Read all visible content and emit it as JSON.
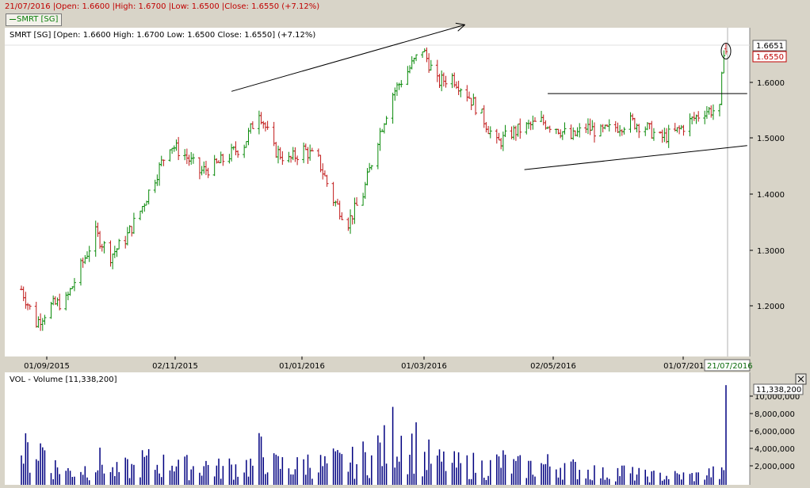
{
  "header": {
    "info_line": "21/07/2016 |Open: 1.6600 |High: 1.6700 |Low: 1.6500 |Close: 1.6550 (+7.12%)",
    "legend_label": "SMRT [SG]"
  },
  "price_panel": {
    "info": "SMRT [SG] [Open: 1.6600  High: 1.6700  Low: 1.6500  Close: 1.6550] (+7.12%)",
    "last_high_label": "1.6651",
    "last_close_label": "1.6550",
    "y_ticks": [
      "1.6000",
      "1.5000",
      "1.4000",
      "1.3000",
      "1.2000"
    ],
    "x_ticks": [
      "01/09/2015",
      "02/11/2015",
      "01/01/2016",
      "01/03/2016",
      "02/05/2016",
      "01/07/2016"
    ],
    "cursor_date": "21/07/2016"
  },
  "volume_panel": {
    "info": "VOL - Volume [11,338,200]",
    "last_label": "11,338,200",
    "y_ticks": [
      "10,000,000",
      "8,000,000",
      "6,000,000",
      "4,000,000",
      "2,000,000"
    ]
  },
  "colors": {
    "up": "#0a8a0a",
    "down": "#c01818",
    "volume": "#000080",
    "background": "#ffffff",
    "frame": "#d8d4c8"
  },
  "chart_data": [
    {
      "type": "ohlc",
      "title": "SMRT [SG]",
      "x_range": [
        "2015-08-24",
        "2016-07-21"
      ],
      "ylim": [
        1.11,
        1.71
      ],
      "grid": false,
      "y_ticks": [
        1.2,
        1.3,
        1.4,
        1.5,
        1.6
      ],
      "close_series": [
        [
          "2015-08-24",
          1.23
        ],
        [
          "2015-08-31",
          1.17
        ],
        [
          "2015-09-07",
          1.2
        ],
        [
          "2015-09-14",
          1.21
        ],
        [
          "2015-09-21",
          1.27
        ],
        [
          "2015-09-28",
          1.33
        ],
        [
          "2015-10-05",
          1.29
        ],
        [
          "2015-10-12",
          1.32
        ],
        [
          "2015-10-19",
          1.37
        ],
        [
          "2015-10-26",
          1.43
        ],
        [
          "2015-11-02",
          1.49
        ],
        [
          "2015-11-09",
          1.47
        ],
        [
          "2015-11-16",
          1.44
        ],
        [
          "2015-11-23",
          1.45
        ],
        [
          "2015-11-30",
          1.47
        ],
        [
          "2015-12-07",
          1.49
        ],
        [
          "2015-12-14",
          1.55
        ],
        [
          "2015-12-21",
          1.48
        ],
        [
          "2015-12-28",
          1.46
        ],
        [
          "2016-01-04",
          1.48
        ],
        [
          "2016-01-11",
          1.46
        ],
        [
          "2016-01-18",
          1.39
        ],
        [
          "2016-01-25",
          1.35
        ],
        [
          "2016-02-01",
          1.4
        ],
        [
          "2016-02-08",
          1.5
        ],
        [
          "2016-02-15",
          1.58
        ],
        [
          "2016-02-22",
          1.62
        ],
        [
          "2016-02-29",
          1.66
        ],
        [
          "2016-03-07",
          1.6
        ],
        [
          "2016-03-14",
          1.61
        ],
        [
          "2016-03-21",
          1.58
        ],
        [
          "2016-03-28",
          1.54
        ],
        [
          "2016-04-04",
          1.49
        ],
        [
          "2016-04-11",
          1.51
        ],
        [
          "2016-04-18",
          1.52
        ],
        [
          "2016-04-25",
          1.53
        ],
        [
          "2016-05-02",
          1.52
        ],
        [
          "2016-05-09",
          1.5
        ],
        [
          "2016-05-16",
          1.52
        ],
        [
          "2016-05-23",
          1.51
        ],
        [
          "2016-05-30",
          1.52
        ],
        [
          "2016-06-06",
          1.53
        ],
        [
          "2016-06-13",
          1.52
        ],
        [
          "2016-06-20",
          1.5
        ],
        [
          "2016-06-27",
          1.51
        ],
        [
          "2016-07-04",
          1.53
        ],
        [
          "2016-07-11",
          1.55
        ],
        [
          "2016-07-18",
          1.55
        ]
      ],
      "last_bar": {
        "date": "2016-07-21",
        "open": 1.66,
        "high": 1.67,
        "low": 1.65,
        "close": 1.655
      }
    },
    {
      "type": "bar",
      "title": "VOL - Volume",
      "ylim": [
        0,
        11500000
      ],
      "y_ticks": [
        2000000,
        4000000,
        6000000,
        8000000,
        10000000
      ],
      "weekly_avg_volume": [
        [
          "2015-08-24",
          3500000
        ],
        [
          "2015-08-31",
          4000000
        ],
        [
          "2015-09-07",
          2000000
        ],
        [
          "2015-09-14",
          1500000
        ],
        [
          "2015-09-21",
          1800000
        ],
        [
          "2015-09-28",
          2500000
        ],
        [
          "2015-10-05",
          1500000
        ],
        [
          "2015-10-12",
          1800000
        ],
        [
          "2015-10-19",
          2500000
        ],
        [
          "2015-10-26",
          2200000
        ],
        [
          "2015-11-02",
          2800000
        ],
        [
          "2015-11-09",
          2000000
        ],
        [
          "2015-11-16",
          2200000
        ],
        [
          "2015-11-23",
          1800000
        ],
        [
          "2015-11-30",
          2000000
        ],
        [
          "2015-12-07",
          2200000
        ],
        [
          "2015-12-14",
          3500000
        ],
        [
          "2015-12-21",
          2200000
        ],
        [
          "2015-12-28",
          2000000
        ],
        [
          "2016-01-04",
          2500000
        ],
        [
          "2016-01-11",
          2200000
        ],
        [
          "2016-01-18",
          2500000
        ],
        [
          "2016-01-25",
          2500000
        ],
        [
          "2016-02-01",
          3000000
        ],
        [
          "2016-02-08",
          4000000
        ],
        [
          "2016-02-15",
          5500000
        ],
        [
          "2016-02-22",
          4500000
        ],
        [
          "2016-02-29",
          3000000
        ],
        [
          "2016-03-07",
          2500000
        ],
        [
          "2016-03-14",
          2200000
        ],
        [
          "2016-03-21",
          2200000
        ],
        [
          "2016-03-28",
          2000000
        ],
        [
          "2016-04-04",
          2500000
        ],
        [
          "2016-04-11",
          2000000
        ],
        [
          "2016-04-18",
          2000000
        ],
        [
          "2016-04-25",
          2200000
        ],
        [
          "2016-05-02",
          2200000
        ],
        [
          "2016-05-09",
          1800000
        ],
        [
          "2016-05-16",
          1500000
        ],
        [
          "2016-05-23",
          1200000
        ],
        [
          "2016-05-30",
          1500000
        ],
        [
          "2016-06-06",
          1200000
        ],
        [
          "2016-06-13",
          1000000
        ],
        [
          "2016-06-20",
          1000000
        ],
        [
          "2016-06-27",
          1000000
        ],
        [
          "2016-07-04",
          1000000
        ],
        [
          "2016-07-11",
          1300000
        ],
        [
          "2016-07-18",
          1200000
        ]
      ],
      "last_value": {
        "date": "2016-07-21",
        "value": 11338200
      }
    }
  ],
  "trend_lines": [
    {
      "from": [
        "2015-12-01",
        1.584
      ],
      "to": [
        "2016-03-20",
        1.703
      ],
      "arrow": true
    },
    {
      "from": [
        "2016-04-17",
        1.444
      ],
      "to": [
        "2016-07-31",
        1.487
      ],
      "arrow": false
    },
    {
      "from": [
        "2016-04-28",
        1.58
      ],
      "to": [
        "2016-07-31",
        1.58
      ],
      "arrow": false
    }
  ],
  "ellipse_marker": {
    "date": "2016-07-21",
    "value": 1.656
  }
}
